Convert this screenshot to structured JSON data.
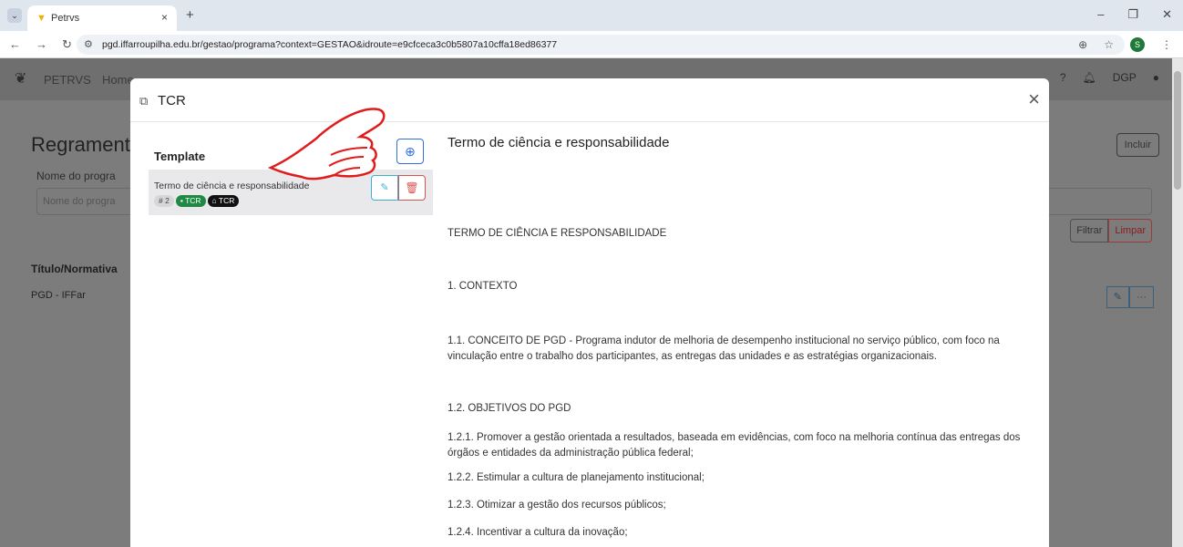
{
  "browser": {
    "tab_title": "Petrvs",
    "tab_close": "×",
    "new_tab": "+",
    "url": "pgd.iffarroupilha.edu.br/gestao/programa?context=GESTAO&idroute=e9cfceca3c0b5807a10cffa18ed86377",
    "profile_initial": "S"
  },
  "app": {
    "brand": "PETRVS",
    "menu_home": "Home",
    "page_title": "Regramento",
    "field_label": "Nome do progra",
    "field_placeholder": "Nome do progra",
    "include_label": "Incluir",
    "filter_label": "Filtrar",
    "clear_label": "Limpar",
    "user_label": "DGP",
    "column_header": "Título/Normativa",
    "row_title": "PGD - IFFar",
    "row_more": "···"
  },
  "modal": {
    "title": "TCR",
    "close": "×",
    "template_heading": "Template",
    "template_item": {
      "name": "Termo de ciência e responsabilidade",
      "id_badge": "# 2",
      "green_badge": "TCR",
      "dark_badge": "TCR"
    }
  },
  "document": {
    "heading": "Termo de ciência e responsabilidade",
    "paragraphs": [
      "TERMO DE CIÊNCIA E RESPONSABILIDADE",
      "1.  CONTEXTO",
      "1.1.  CONCEITO DE PGD - Programa indutor de melhoria de desempenho institucional no serviço público, com foco na vinculação entre o trabalho dos participantes, as entregas das unidades e as estratégias organizacionais.",
      "1.2.  OBJETIVOS DO PGD",
      "1.2.1.   Promover a gestão orientada a resultados, baseada em evidências, com foco na melhoria contínua das entregas dos órgãos e entidades da administração pública federal;",
      "1.2.2.   Estimular a cultura de planejamento institucional;",
      "1.2.3.   Otimizar a gestão dos recursos públicos;",
      "1.2.4.   Incentivar a cultura da inovação;"
    ]
  },
  "colors": {
    "primary": "#2f6edb",
    "info": "#3bb0d9",
    "danger": "#d9534f",
    "success": "#1e8a44"
  }
}
